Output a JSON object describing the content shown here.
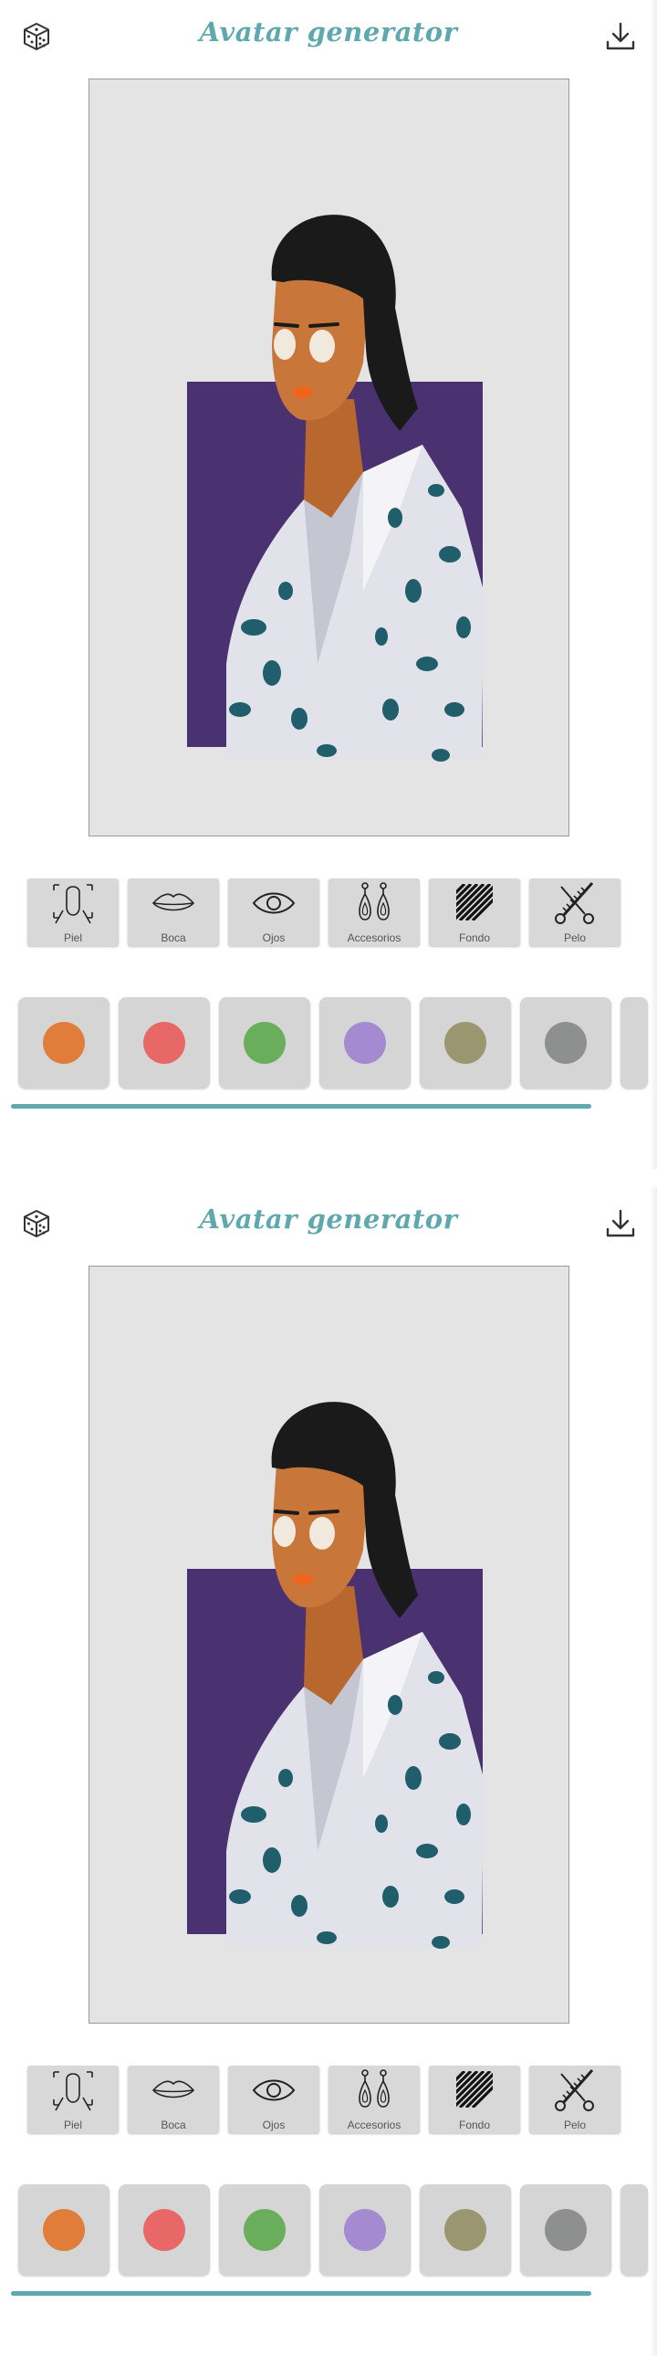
{
  "screens": [
    {
      "title": "Avatar generator",
      "tabs": [
        {
          "label": "Piel",
          "icon": "face-outline-icon"
        },
        {
          "label": "Boca",
          "icon": "lips-icon"
        },
        {
          "label": "Ojos",
          "icon": "eye-icon"
        },
        {
          "label": "Accesorios",
          "icon": "earrings-icon"
        },
        {
          "label": "Fondo",
          "icon": "stripes-icon"
        },
        {
          "label": "Pelo",
          "icon": "scissors-comb-icon"
        }
      ],
      "swatches": [
        "#e07d3a",
        "#e86868",
        "#6aae5c",
        "#a48ad0",
        "#9a9670",
        "#8e9090"
      ]
    },
    {
      "title": "Avatar generator",
      "tabs": [
        {
          "label": "Piel",
          "icon": "face-outline-icon"
        },
        {
          "label": "Boca",
          "icon": "lips-icon"
        },
        {
          "label": "Ojos",
          "icon": "eye-icon"
        },
        {
          "label": "Accesorios",
          "icon": "earrings-icon"
        },
        {
          "label": "Fondo",
          "icon": "stripes-icon"
        },
        {
          "label": "Pelo",
          "icon": "scissors-comb-icon"
        }
      ],
      "swatches": [
        "#e07d3a",
        "#e86868",
        "#6aae5c",
        "#a48ad0",
        "#9a9670",
        "#8e9090"
      ]
    }
  ],
  "icons": {
    "randomize": "dice-icon",
    "download": "download-icon"
  },
  "colors": {
    "accent": "#5fa8ad",
    "background_rect": "#4a3170",
    "skin": "#c8763a",
    "hair": "#1a1a1a",
    "lips": "#f0641e",
    "shirt": "#e2e3ea",
    "pattern": "#1f5e6a"
  }
}
